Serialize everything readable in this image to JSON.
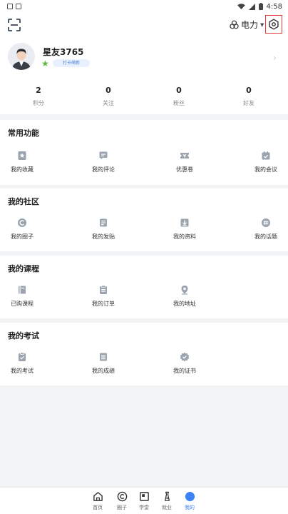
{
  "status": {
    "time": "4:58"
  },
  "header": {
    "power_label": "电力"
  },
  "profile": {
    "username": "星友3765",
    "badge": "打卡萌新"
  },
  "stats": [
    {
      "value": "2",
      "label": "积分"
    },
    {
      "value": "0",
      "label": "关注"
    },
    {
      "value": "0",
      "label": "粉丝"
    },
    {
      "value": "0",
      "label": "好友"
    }
  ],
  "sections": [
    {
      "title": "常用功能",
      "items": [
        {
          "label": "我的收藏",
          "icon": "star-bookmark-icon"
        },
        {
          "label": "我的评论",
          "icon": "comment-icon"
        },
        {
          "label": "优惠卷",
          "icon": "coupon-icon"
        },
        {
          "label": "我的会议",
          "icon": "meeting-icon"
        }
      ]
    },
    {
      "title": "我的社区",
      "items": [
        {
          "label": "我的圈子",
          "icon": "circle-icon"
        },
        {
          "label": "我的发贴",
          "icon": "post-icon"
        },
        {
          "label": "我的资料",
          "icon": "download-icon"
        },
        {
          "label": "我的话题",
          "icon": "topic-icon"
        }
      ]
    },
    {
      "title": "我的课程",
      "items": [
        {
          "label": "已购课程",
          "icon": "course-icon"
        },
        {
          "label": "我的订单",
          "icon": "order-icon"
        },
        {
          "label": "我的地址",
          "icon": "location-icon"
        }
      ]
    },
    {
      "title": "我的考试",
      "items": [
        {
          "label": "我的考试",
          "icon": "exam-icon"
        },
        {
          "label": "我的成绩",
          "icon": "score-icon"
        },
        {
          "label": "我的证书",
          "icon": "certificate-icon"
        }
      ]
    }
  ],
  "tabs": [
    {
      "label": "首页",
      "icon": "home-icon"
    },
    {
      "label": "圈子",
      "icon": "circle-tab-icon"
    },
    {
      "label": "学堂",
      "icon": "school-icon"
    },
    {
      "label": "就业",
      "icon": "job-icon"
    },
    {
      "label": "我的",
      "icon": "me-icon",
      "active": true
    }
  ],
  "colors": {
    "accent": "#3b82f6",
    "icon_gray": "#9aa3ae",
    "highlight_box": "#e53935"
  }
}
